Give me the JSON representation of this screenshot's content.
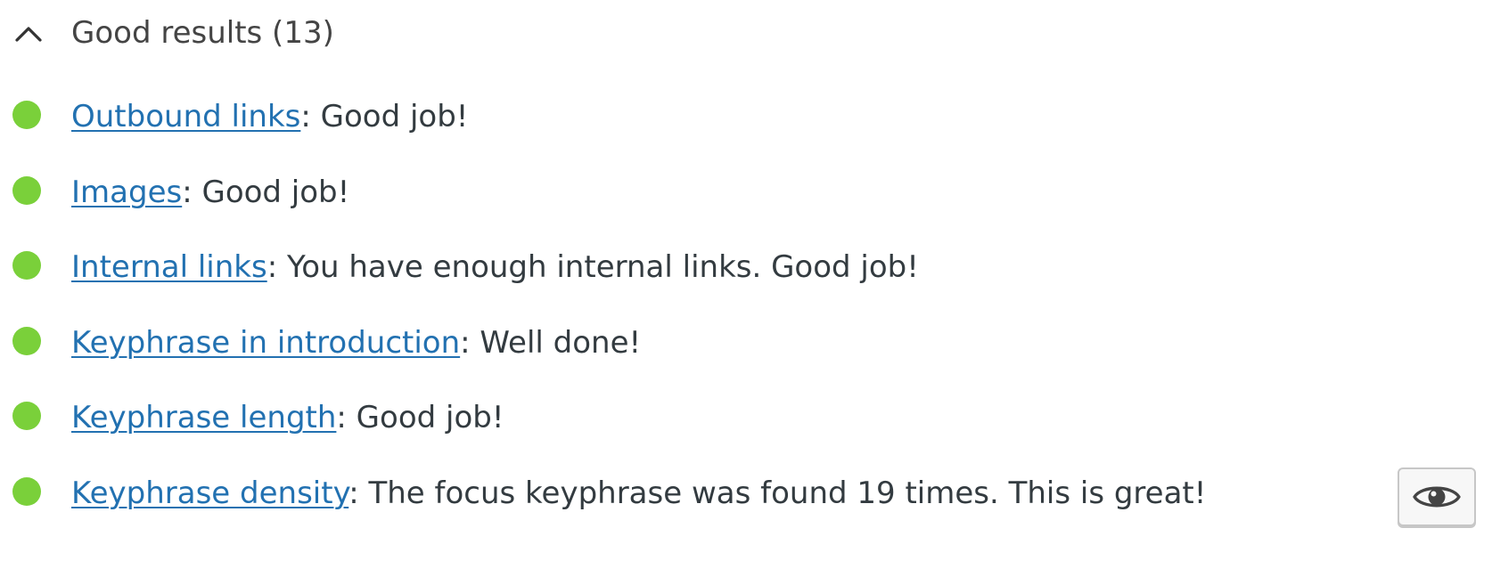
{
  "section": {
    "title": "Good results (13)",
    "collapse_icon": "chevron-up-icon"
  },
  "results": [
    {
      "link": "Outbound links",
      "text": ": Good job!",
      "status": "good"
    },
    {
      "link": "Images",
      "text": ": Good job!",
      "status": "good"
    },
    {
      "link": "Internal links",
      "text": ": You have enough internal links. Good job!",
      "status": "good"
    },
    {
      "link": "Keyphrase in introduction",
      "text": ": Well done!",
      "status": "good"
    },
    {
      "link": "Keyphrase length",
      "text": ": Good job!",
      "status": "good"
    },
    {
      "link": "Keyphrase density",
      "text": ": The focus keyphrase was found 19 times. This is great!",
      "status": "good"
    }
  ],
  "colors": {
    "good": "#7ad03a",
    "link": "#2271b1",
    "text": "#333b40"
  },
  "icons": {
    "status": "status-dot-icon",
    "highlight_button": "eye-icon"
  }
}
